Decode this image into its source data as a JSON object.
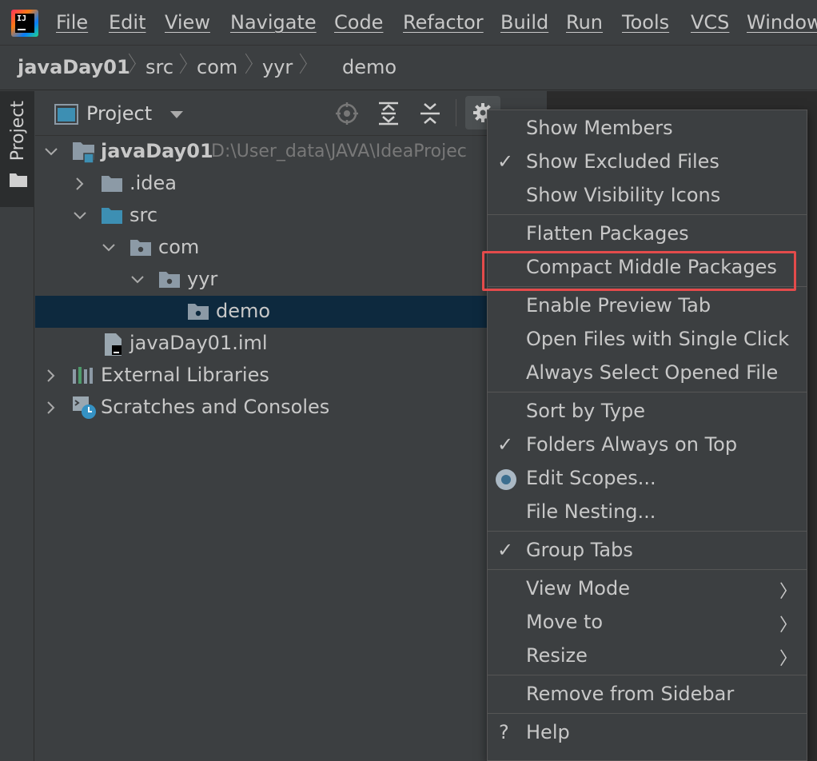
{
  "menubar": {
    "items": [
      "File",
      "Edit",
      "View",
      "Navigate",
      "Code",
      "Refactor",
      "Build",
      "Run",
      "Tools",
      "VCS",
      "Window"
    ]
  },
  "logo": {
    "text": "IJ"
  },
  "breadcrumb": {
    "items": [
      "javaDay01",
      "src",
      "com",
      "yyr",
      "demo"
    ]
  },
  "sidebar": {
    "tab_label": "Project"
  },
  "panel": {
    "title": "Project"
  },
  "tree": {
    "root_label": "javaDay01",
    "root_path": "D:\\User_data\\JAVA\\IdeaProjec",
    "idea": ".idea",
    "src": "src",
    "com": "com",
    "yyr": "yyr",
    "demo": "demo",
    "iml": "javaDay01.iml",
    "ext_libs": "External Libraries",
    "scratches": "Scratches and Consoles"
  },
  "popup": {
    "show_members": "Show Members",
    "show_excluded": "Show Excluded Files",
    "show_visibility": "Show Visibility Icons",
    "flatten": "Flatten Packages",
    "compact": "Compact Middle Packages",
    "preview_tab": "Enable Preview Tab",
    "single_click": "Open Files with Single Click",
    "always_select": "Always Select Opened File",
    "sort_type": "Sort by Type",
    "folders_top": "Folders Always on Top",
    "edit_scopes": "Edit Scopes...",
    "file_nesting": "File Nesting...",
    "group_tabs": "Group Tabs",
    "view_mode": "View Mode",
    "move_to": "Move to",
    "resize": "Resize",
    "remove_sidebar": "Remove from Sidebar",
    "help": "Help",
    "check": "✓",
    "arrow": "〉",
    "question": "?"
  },
  "colors": {
    "background": "#3c3f41",
    "selection": "#0d293e",
    "highlight": "#e44b4b",
    "folder": "#8c9aa6",
    "source_folder": "#3d8fb3"
  }
}
